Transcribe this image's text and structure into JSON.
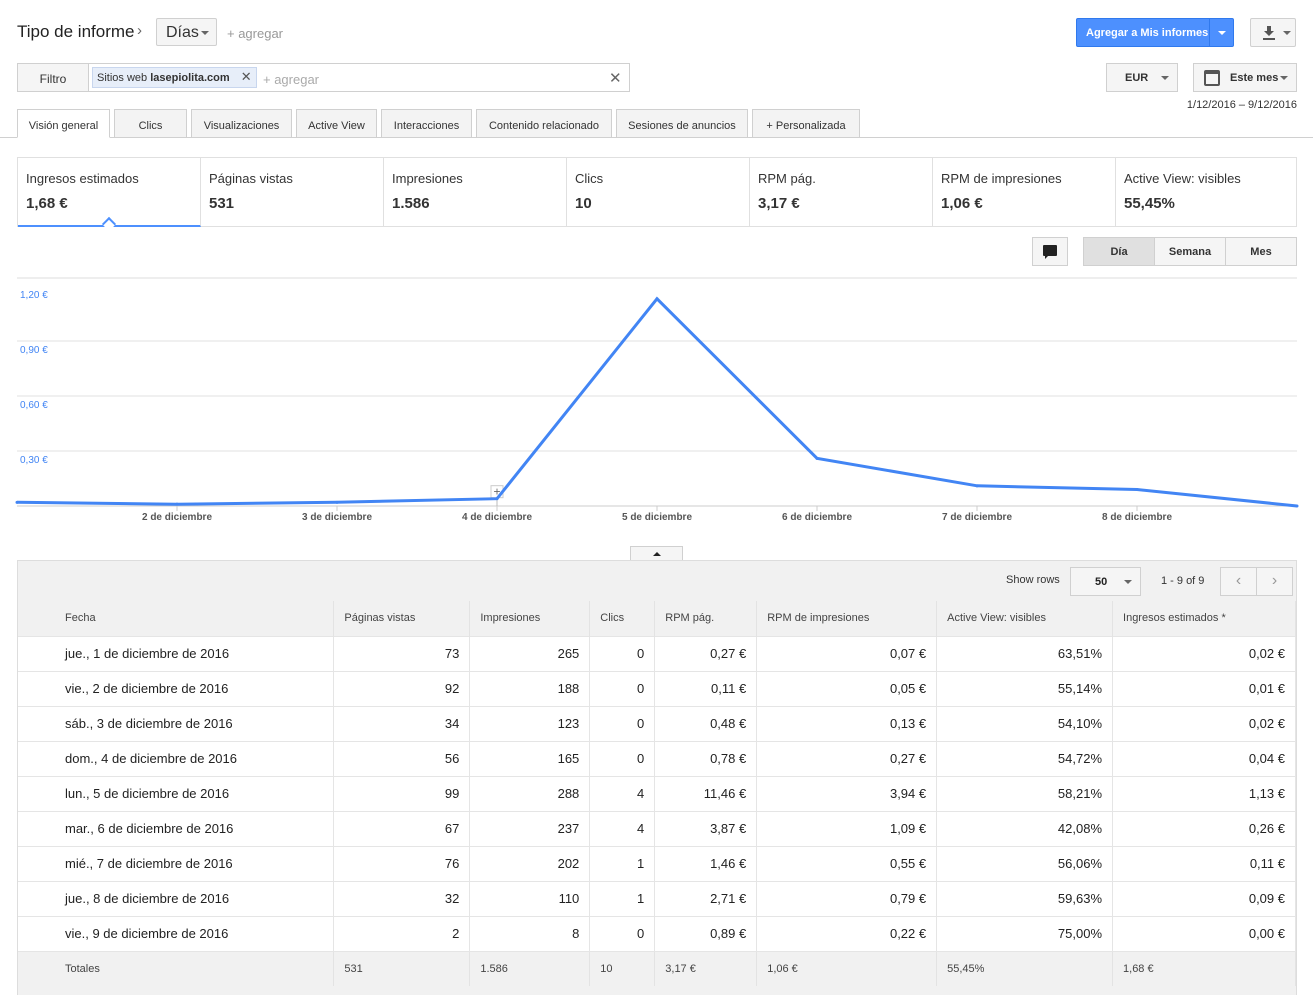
{
  "header": {
    "title": "Tipo de informe",
    "chevron": "›",
    "dimension": "Días",
    "add_dimension": "+ agregar",
    "add_to_reports": "Agregar a Mis informes",
    "download_icon": "download-icon"
  },
  "filter": {
    "label": "Filtro",
    "chip_prefix": "Sitios web",
    "chip_value": "lasepiolita.com",
    "add_placeholder": "+ agregar",
    "currency": "EUR",
    "period": "Este mes",
    "date_range": "1/12/2016 – 9/12/2016"
  },
  "tabs": [
    {
      "label": "Visión general"
    },
    {
      "label": "Clics"
    },
    {
      "label": "Visualizaciones"
    },
    {
      "label": "Active View"
    },
    {
      "label": "Interacciones"
    },
    {
      "label": "Contenido relacionado"
    },
    {
      "label": "Sesiones de anuncios"
    },
    {
      "label": "+  Personalizada"
    }
  ],
  "metrics": [
    {
      "name": "Ingresos estimados",
      "value": "1,68 €"
    },
    {
      "name": "Páginas vistas",
      "value": "531"
    },
    {
      "name": "Impresiones",
      "value": "1.586"
    },
    {
      "name": "Clics",
      "value": "10"
    },
    {
      "name": "RPM pág.",
      "value": "3,17 €"
    },
    {
      "name": "RPM de impresiones",
      "value": "1,06 €"
    },
    {
      "name": "Active View: visibles",
      "value": "55,45%"
    }
  ],
  "granularity": {
    "day": "Día",
    "week": "Semana",
    "month": "Mes"
  },
  "chart_data": {
    "type": "line",
    "series": [
      {
        "values": [
          0.02,
          0.01,
          0.02,
          0.04,
          1.13,
          0.26,
          0.11,
          0.09,
          0.0
        ]
      }
    ],
    "x": [
      "1 de diciembre",
      "2 de diciembre",
      "3 de diciembre",
      "4 de diciembre",
      "5 de diciembre",
      "6 de diciembre",
      "7 de diciembre",
      "8 de diciembre",
      "9 de diciembre"
    ],
    "x_tick_labels": [
      "2 de diciembre",
      "3 de diciembre",
      "4 de diciembre",
      "5 de diciembre",
      "6 de diciembre",
      "7 de diciembre",
      "8 de diciembre"
    ],
    "y_tick_labels": [
      "1,20 €",
      "0,90 €",
      "0,60 €",
      "0,30 €"
    ],
    "y_ticks": [
      1.2,
      0.9,
      0.6,
      0.3
    ],
    "ylim": [
      0,
      1.2
    ],
    "grid": true,
    "color": "#4285f4"
  },
  "table": {
    "show_rows_label": "Show rows",
    "rows_value": "50",
    "page_count": "1 - 9 of 9",
    "prev": "‹",
    "next": "›",
    "columns": [
      "Fecha",
      "Páginas vistas",
      "Impresiones",
      "Clics",
      "RPM pág.",
      "RPM de impresiones",
      "Active View: visibles",
      "Ingresos estimados *"
    ],
    "rows": [
      [
        "jue., 1 de diciembre de 2016",
        "73",
        "265",
        "0",
        "0,27 €",
        "0,07 €",
        "63,51%",
        "0,02 €"
      ],
      [
        "vie., 2 de diciembre de 2016",
        "92",
        "188",
        "0",
        "0,11 €",
        "0,05 €",
        "55,14%",
        "0,01 €"
      ],
      [
        "sáb., 3 de diciembre de 2016",
        "34",
        "123",
        "0",
        "0,48 €",
        "0,13 €",
        "54,10%",
        "0,02 €"
      ],
      [
        "dom., 4 de diciembre de 2016",
        "56",
        "165",
        "0",
        "0,78 €",
        "0,27 €",
        "54,72%",
        "0,04 €"
      ],
      [
        "lun., 5 de diciembre de 2016",
        "99",
        "288",
        "4",
        "11,46 €",
        "3,94 €",
        "58,21%",
        "1,13 €"
      ],
      [
        "mar., 6 de diciembre de 2016",
        "67",
        "237",
        "4",
        "3,87 €",
        "1,09 €",
        "42,08%",
        "0,26 €"
      ],
      [
        "mié., 7 de diciembre de 2016",
        "76",
        "202",
        "1",
        "1,46 €",
        "0,55 €",
        "56,06%",
        "0,11 €"
      ],
      [
        "jue., 8 de diciembre de 2016",
        "32",
        "110",
        "1",
        "2,71 €",
        "0,79 €",
        "59,63%",
        "0,09 €"
      ],
      [
        "vie., 9 de diciembre de 2016",
        "2",
        "8",
        "0",
        "0,89 €",
        "0,22 €",
        "75,00%",
        "0,00 €"
      ]
    ],
    "totals": [
      "Totales",
      "531",
      "1.586",
      "10",
      "3,17 €",
      "1,06 €",
      "55,45%",
      "1,68 €"
    ]
  }
}
